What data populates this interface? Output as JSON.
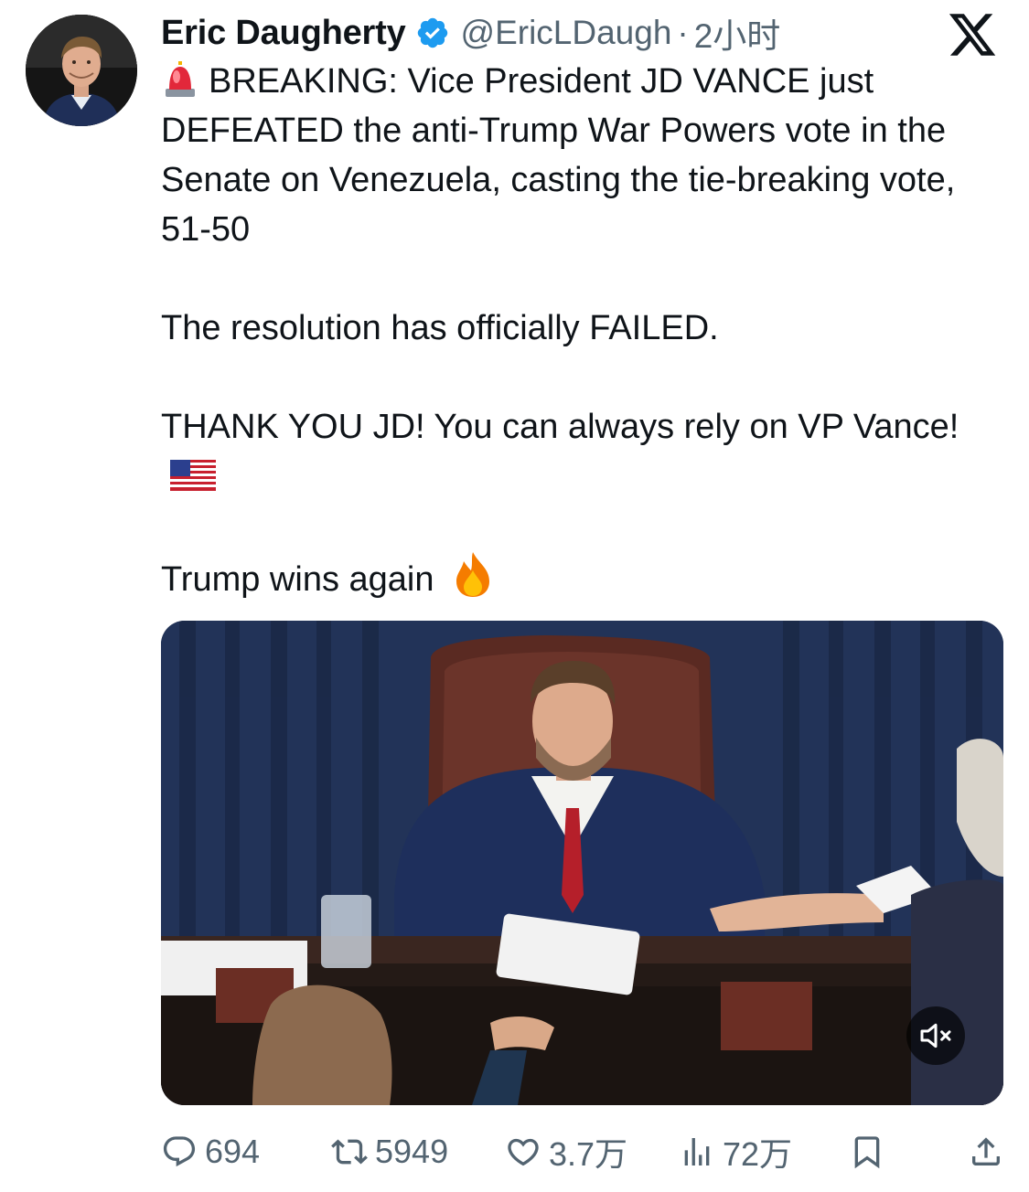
{
  "author": {
    "display_name": "Eric Daugherty",
    "handle": "@EricLDaugh",
    "separator": "·",
    "time": "2小时"
  },
  "tweet": {
    "line1": "BREAKING: Vice President JD VANCE just DEFEATED the anti-Trump War Powers vote in the Senate on Venezuela, casting the tie-breaking vote, 51-50",
    "line2": "The resolution has officially FAILED.",
    "line3": "THANK YOU JD! You can always rely on VP Vance!",
    "line4": "Trump wins again"
  },
  "media": {
    "type": "video",
    "muted": true
  },
  "metrics": {
    "replies": "694",
    "reposts": "5949",
    "likes": "3.7万",
    "views": "72万"
  },
  "icons": {
    "verified": "verified-badge-icon",
    "platform": "x-logo-icon",
    "reply": "reply-icon",
    "repost": "repost-icon",
    "like": "heart-icon",
    "views": "views-bar-chart-icon",
    "bookmark": "bookmark-icon",
    "share": "share-icon",
    "mute": "speaker-muted-icon",
    "emoji_1": "police-light-emoji",
    "emoji_2": "us-flag-emoji",
    "emoji_3": "fire-emoji"
  },
  "colors": {
    "text": "#0f1419",
    "secondary": "#536471",
    "verified": "#1d9bf0"
  }
}
